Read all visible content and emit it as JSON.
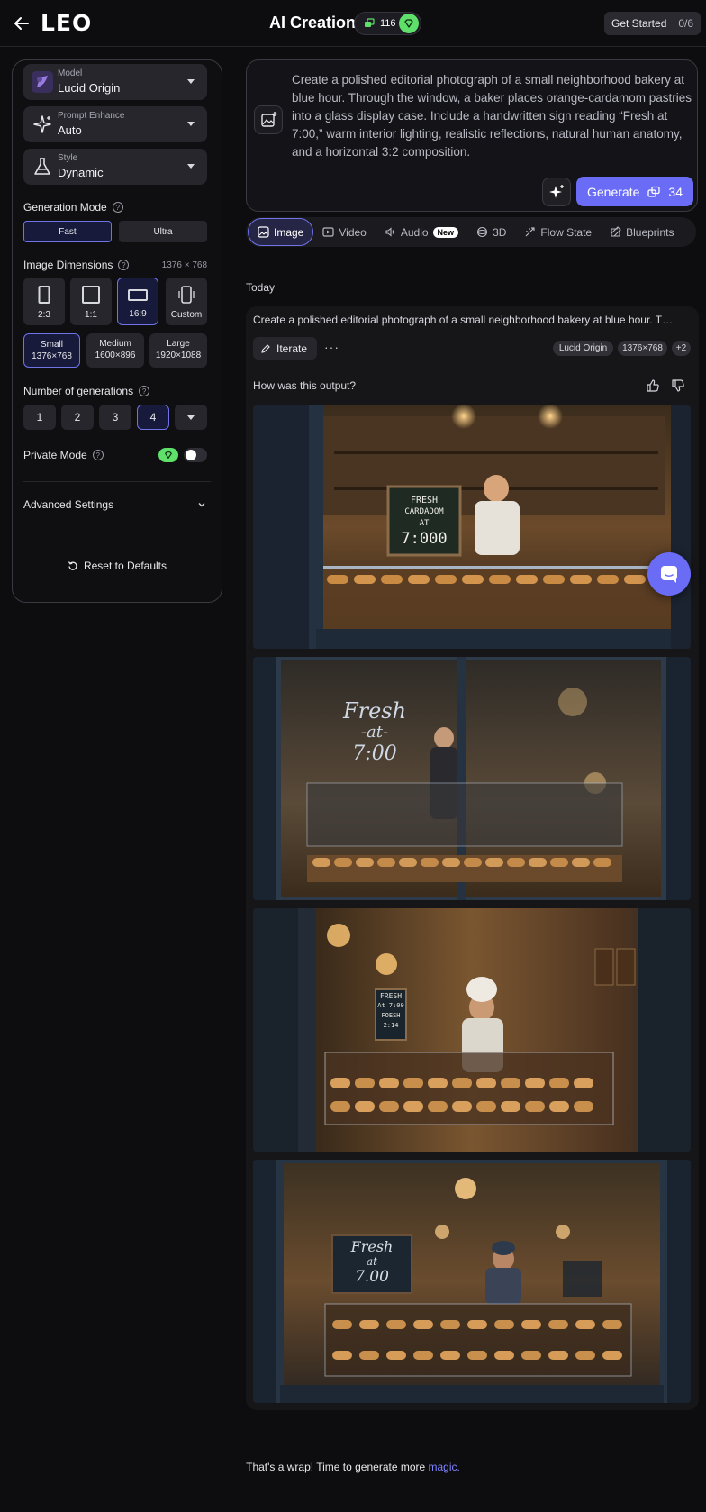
{
  "header": {
    "logo": "LEO",
    "title": "AI Creation",
    "tokens": "116",
    "get_started": "Get Started",
    "get_started_count": "0/6"
  },
  "sidebar": {
    "model": {
      "label": "Model",
      "value": "Lucid Origin"
    },
    "prompt_enhance": {
      "label": "Prompt Enhance",
      "value": "Auto"
    },
    "style": {
      "label": "Style",
      "value": "Dynamic"
    },
    "generation_mode": {
      "label": "Generation Mode",
      "options": [
        "Fast",
        "Ultra"
      ],
      "selected": "Fast"
    },
    "image_dimensions": {
      "label": "Image Dimensions",
      "current": "1376 × 768",
      "ratios": [
        "2:3",
        "1:1",
        "16:9",
        "Custom"
      ],
      "selected_ratio": "16:9",
      "sizes": [
        {
          "name": "Small",
          "dims": "1376×768"
        },
        {
          "name": "Medium",
          "dims": "1600×896"
        },
        {
          "name": "Large",
          "dims": "1920×1088"
        }
      ],
      "selected_size": "Small"
    },
    "num_generations": {
      "label": "Number of generations",
      "options": [
        "1",
        "2",
        "3",
        "4"
      ],
      "selected": "4"
    },
    "private_mode": {
      "label": "Private Mode",
      "enabled": false
    },
    "advanced": "Advanced Settings",
    "reset": "Reset to Defaults"
  },
  "prompt": {
    "text": "Create a polished editorial photograph of a small neighborhood bakery at blue hour. Through the window, a baker places orange-cardamom pastries into a glass display case. Include a handwritten sign reading “Fresh at 7:00,” warm interior lighting, realistic reflections, natural human anatomy, and a horizontal 3:2 composition.",
    "generate_label": "Generate",
    "generate_cost": "34"
  },
  "tabs": [
    {
      "label": "Image",
      "icon": "image-icon",
      "active": true
    },
    {
      "label": "Video",
      "icon": "video-icon"
    },
    {
      "label": "Audio",
      "icon": "audio-icon",
      "badge": "New"
    },
    {
      "label": "3D",
      "icon": "cube-icon"
    },
    {
      "label": "Flow State",
      "icon": "flow-icon"
    },
    {
      "label": "Blueprints",
      "icon": "blueprint-icon"
    }
  ],
  "today_label": "Today",
  "result": {
    "prompt_preview": "Create a polished editorial photograph of a small neighborhood bakery at blue hour. Through the window, a baker places orange-cardamom pastries into a glass display case.",
    "iterate_label": "Iterate",
    "chips": [
      "Lucid Origin",
      "1376×768",
      "+2"
    ],
    "feedback_question": "How was this output?",
    "images": [
      {
        "sign_lines": [
          "FRESH",
          "CARDADOM",
          "AT",
          "7:000"
        ],
        "sign_style": "chalk-board"
      },
      {
        "sign_lines": [
          "Fresh",
          "-at-",
          "7:00"
        ],
        "sign_style": "window-script"
      },
      {
        "sign_lines": [
          "FRESH",
          "At 7:00",
          "FOESH",
          "2:14"
        ],
        "sign_style": "small-board"
      },
      {
        "sign_lines": [
          "Fresh",
          "at",
          "7.00"
        ],
        "sign_style": "chalk-board"
      }
    ]
  },
  "footer": {
    "text": "That's a wrap! Time to generate more ",
    "link": "magic."
  },
  "colors": {
    "accent": "#6a6cf6",
    "token_green": "#5ee06a",
    "background": "#0d0d0f"
  }
}
